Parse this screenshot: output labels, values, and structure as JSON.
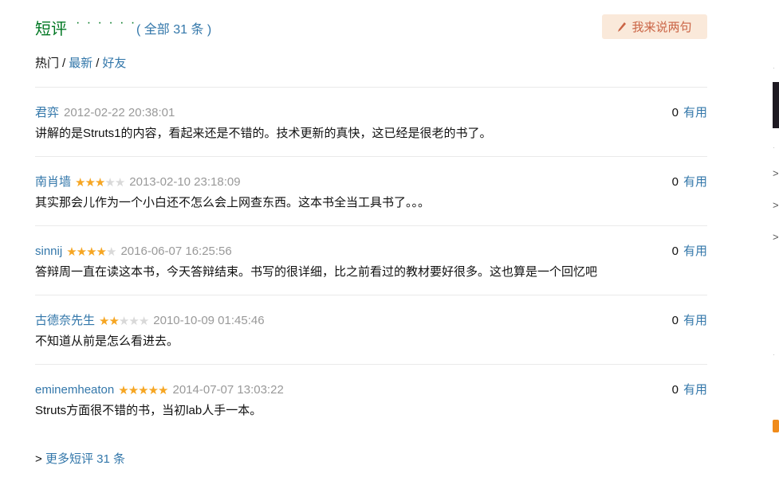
{
  "header": {
    "title": "短评",
    "dots": "· · · · · ·",
    "count_label": "( 全部 31 条 )",
    "write_button": "我来说两句"
  },
  "filters": [
    {
      "label": "热门",
      "active": true
    },
    {
      "label": "最新",
      "active": false
    },
    {
      "label": "好友",
      "active": false
    }
  ],
  "filter_separator": "/",
  "comments": [
    {
      "user": "君弈",
      "rating": 0,
      "time": "2012-02-22 20:38:01",
      "votes": "0",
      "useful_label": "有用",
      "content": "讲解的是Struts1的内容，看起来还是不错的。技术更新的真快，这已经是很老的书了。"
    },
    {
      "user": "南肖墙",
      "rating": 3,
      "time": "2013-02-10 23:18:09",
      "votes": "0",
      "useful_label": "有用",
      "content": "其实那会儿作为一个小白还不怎么会上网查东西。这本书全当工具书了。。。"
    },
    {
      "user": "sinnij",
      "rating": 4,
      "time": "2016-06-07 16:25:56",
      "votes": "0",
      "useful_label": "有用",
      "content": "答辩周一直在读这本书，今天答辩结束。书写的很详细，比之前看过的教材要好很多。这也算是一个回忆吧"
    },
    {
      "user": "古德奈先生",
      "rating": 2,
      "time": "2010-10-09 01:45:46",
      "votes": "0",
      "useful_label": "有用",
      "content": "不知道从前是怎么看进去。"
    },
    {
      "user": "eminemheaton",
      "rating": 5,
      "time": "2014-07-07 13:03:22",
      "votes": "0",
      "useful_label": "有用",
      "content": "Struts方面很不错的书，当初lab人手一本。"
    }
  ],
  "more_link": {
    "prefix": ">",
    "label": "更多短评 31 条"
  },
  "colors": {
    "title_green": "#007722",
    "link_blue": "#3377aa",
    "star_orange": "#f6a623",
    "button_bg": "#fae9da",
    "button_text": "#ca6445"
  }
}
